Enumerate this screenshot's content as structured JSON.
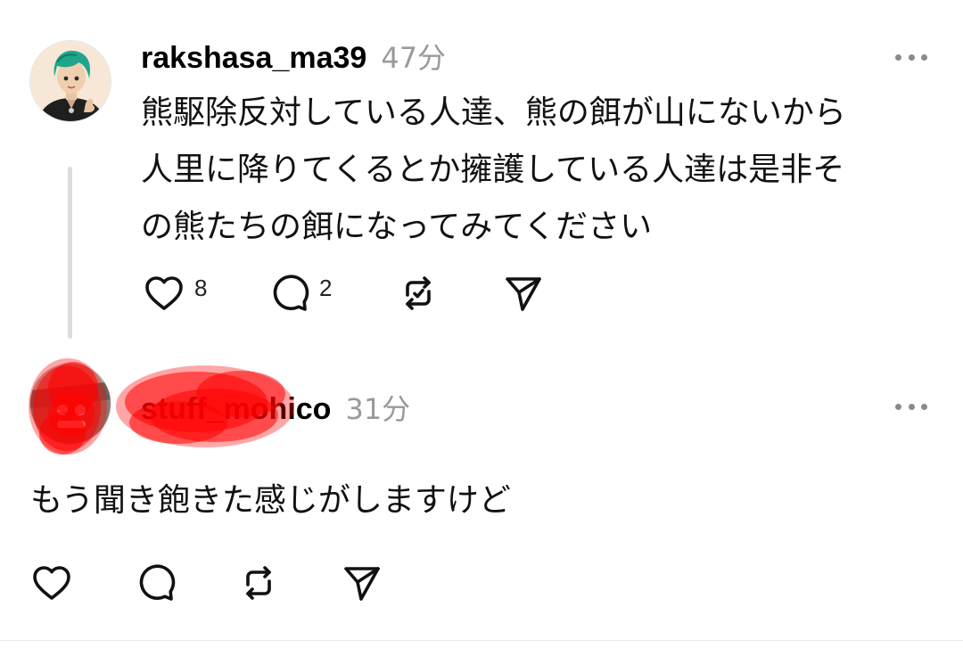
{
  "posts": [
    {
      "username": "rakshasa_ma39",
      "time": "47分",
      "text_lines": [
        "熊駆除反対している人達、熊の餌が山にないから",
        "人里に降りてくるとか擁護している人達は是非そ",
        "の熊たちの餌になってみてください"
      ],
      "likes": "8",
      "replies": "2"
    },
    {
      "username": "stuff_mohico",
      "time": "31分",
      "text": "もう聞き飽きた感じがしますけど"
    }
  ],
  "icons": {
    "like": "heart-icon",
    "reply": "comment-icon",
    "repost": "repost-icon",
    "share": "send-icon",
    "more": "more-icon"
  },
  "colors": {
    "text": "#000000",
    "muted": "#9a9a9a",
    "redaction": "#ff0000"
  }
}
